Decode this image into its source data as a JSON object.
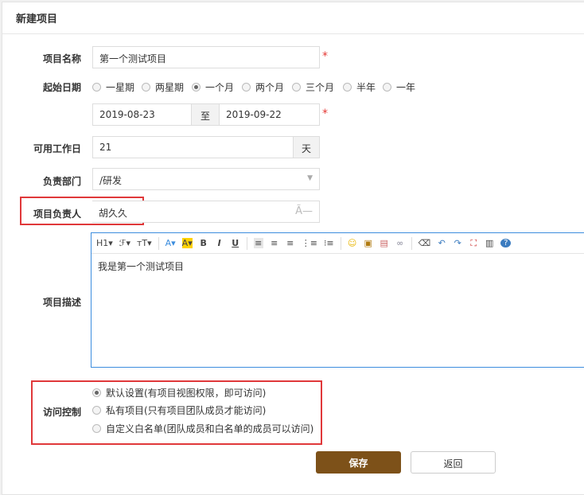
{
  "header": {
    "title": "新建项目"
  },
  "fields": {
    "name": {
      "label": "项目名称",
      "value": "第一个测试项目",
      "required": "*"
    },
    "start": {
      "label": "起始日期",
      "options": [
        "一星期",
        "两星期",
        "一个月",
        "两个月",
        "三个月",
        "半年",
        "一年"
      ],
      "selected": "一个月",
      "from": "2019-08-23",
      "to_label": "至",
      "to": "2019-09-22",
      "required": "*"
    },
    "workdays": {
      "label": "可用工作日",
      "value": "21",
      "unit": "天"
    },
    "dept": {
      "label": "负责部门",
      "value": "/研发"
    },
    "owner": {
      "label": "项目负责人",
      "value": "胡久久"
    },
    "desc": {
      "label": "项目描述",
      "value": "我是第一个测试项目",
      "toolbar": [
        "H1▾",
        "ℱ▾",
        "ᴛT▾",
        "A▾",
        "A▾",
        "B",
        "I",
        "U"
      ]
    },
    "access": {
      "label": "访问控制",
      "options": [
        "默认设置(有项目视图权限，即可访问)",
        "私有项目(只有项目团队成员才能访问)",
        "自定义白名单(团队成员和白名单的成员可以访问)"
      ],
      "selected": 0
    }
  },
  "actions": {
    "save": "保存",
    "back": "返回"
  },
  "colors": {
    "save": "#7d5119",
    "required": "#e53935",
    "highlight": "#e0383a"
  }
}
